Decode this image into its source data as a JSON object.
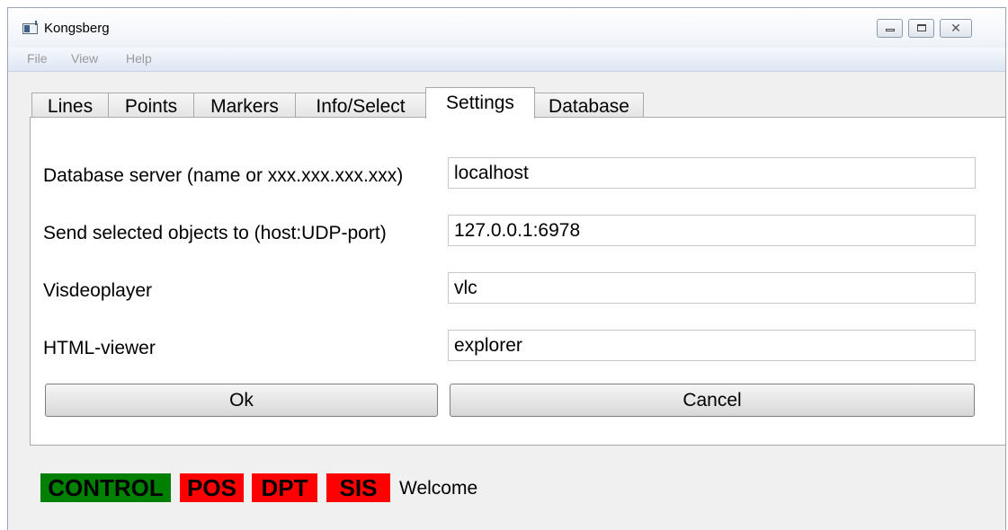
{
  "window": {
    "title": "Kongsberg"
  },
  "menu": {
    "items": [
      "File",
      "View",
      "Help"
    ]
  },
  "tabs": [
    {
      "label": "Lines"
    },
    {
      "label": "Points"
    },
    {
      "label": "Markers"
    },
    {
      "label": "Info/Select"
    },
    {
      "label": "Settings",
      "active": true
    },
    {
      "label": "Database"
    }
  ],
  "settings": {
    "db_server_label": "Database server (name or xxx.xxx.xxx.xxx)",
    "db_server_value": "localhost",
    "send_label": "Send selected objects to (host:UDP-port)",
    "send_value": "127.0.0.1:6978",
    "video_label": "Visdeoplayer",
    "video_value": "vlc",
    "html_label": "HTML-viewer",
    "html_value": "explorer",
    "ok_label": "Ok",
    "cancel_label": "Cancel"
  },
  "status": {
    "badges": [
      {
        "label": "CONTROL",
        "color": "#008000"
      },
      {
        "label": "POS",
        "color": "#ff0000"
      },
      {
        "label": "DPT",
        "color": "#ff0000"
      },
      {
        "label": "SIS",
        "color": "#ff0000"
      }
    ],
    "message": "Welcome"
  }
}
